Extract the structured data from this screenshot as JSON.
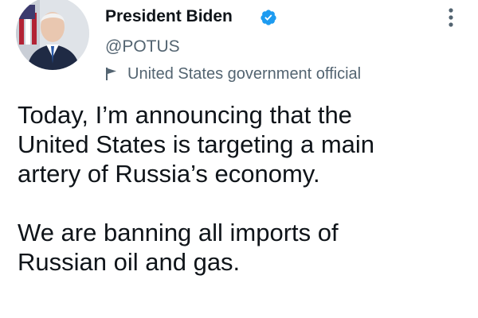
{
  "author": {
    "display_name": "President Biden",
    "handle": "@POTUS",
    "label": "United States government official",
    "avatar_icon": "profile-photo",
    "verified_icon": "verified-badge-icon",
    "label_icon": "flag-icon"
  },
  "tweet": {
    "line1": "Today, I’m announcing that the",
    "line2": "United States is targeting a main",
    "line3": "artery of Russia’s economy.",
    "line4": "We are banning all imports of",
    "line5": "Russian oil and gas."
  },
  "menu_icon": "more-options-icon",
  "colors": {
    "verified": "#1d9bf0",
    "secondary_text": "#536471",
    "primary_text": "#0f1419"
  }
}
